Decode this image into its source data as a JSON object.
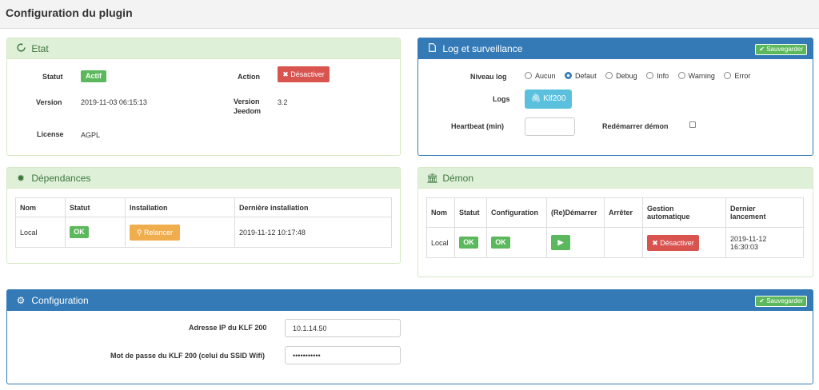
{
  "page": {
    "title": "Configuration du plugin"
  },
  "etat": {
    "title": "Etat",
    "statut_label": "Statut",
    "statut_value": "Actif",
    "action_label": "Action",
    "action_button": "Désactiver",
    "version_label": "Version",
    "version_value": "2019-11-03 06:15:13",
    "version_jeedom_label_1": "Version",
    "version_jeedom_label_2": "Jeedom",
    "version_jeedom_value": "3.2",
    "license_label": "License",
    "license_value": "AGPL"
  },
  "log": {
    "title": "Log et surveillance",
    "save_label": "Sauvegarder",
    "niveau_label": "Niveau log",
    "levels": [
      "Aucun",
      "Defaut",
      "Debug",
      "Info",
      "Warning",
      "Error"
    ],
    "selected_level": "Defaut",
    "logs_label": "Logs",
    "logs_button": "Klf200",
    "heartbeat_label": "Heartbeat (min)",
    "heartbeat_value": "",
    "restart_label": "Redémarrer démon"
  },
  "dependances": {
    "title": "Dépendances",
    "headers": [
      "Nom",
      "Statut",
      "Installation",
      "Dernière installation"
    ],
    "row": {
      "nom": "Local",
      "statut": "OK",
      "installation": "Relancer",
      "derniere": "2019-11-12 10:17:48"
    }
  },
  "demon": {
    "title": "Démon",
    "headers": [
      "Nom",
      "Statut",
      "Configuration",
      "(Re)Démarrer",
      "Arrêter",
      "Gestion",
      "automatique",
      "Dernier",
      "lancement"
    ],
    "row": {
      "nom": "Local",
      "statut": "OK",
      "configuration": "OK",
      "gestion": "Désactiver",
      "dernier_1": "2019-11-12",
      "dernier_2": "16:30:03"
    }
  },
  "config": {
    "title": "Configuration",
    "save_label": "Sauvegarder",
    "ip_label": "Adresse IP du KLF 200",
    "ip_value": "10.1.14.50",
    "password_label": "Mot de passe du KLF 200 (celui du SSID Wifi)",
    "password_value": "•••••••••••"
  },
  "colors": {
    "success": "#5cb85c",
    "danger": "#d9534f",
    "warning": "#f0ad4e",
    "info": "#5bc0de",
    "primary": "#337ab7"
  },
  "icons": {
    "etat": "refresh-icon",
    "log": "file-icon",
    "dependances": "gear-icon",
    "demon": "bank-icon",
    "config": "gears-icon"
  }
}
